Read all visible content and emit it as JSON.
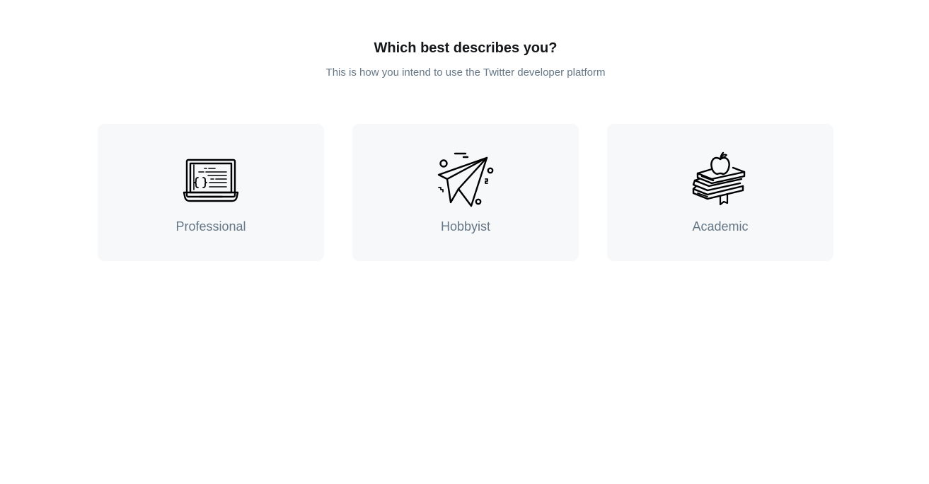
{
  "header": {
    "title": "Which best describes you?",
    "subtitle": "This is how you intend to use the Twitter developer platform"
  },
  "options": [
    {
      "label": "Professional",
      "icon": "laptop-code-icon"
    },
    {
      "label": "Hobbyist",
      "icon": "paper-plane-icon"
    },
    {
      "label": "Academic",
      "icon": "books-apple-icon"
    }
  ],
  "colors": {
    "title": "#14171a",
    "subtitle": "#657786",
    "card_background": "#f7f8fa",
    "page_background": "#ffffff"
  }
}
